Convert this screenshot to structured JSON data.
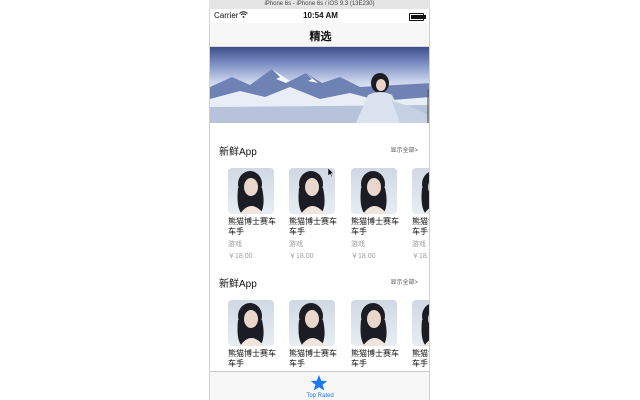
{
  "simulator": {
    "title": "iPhone 6s - iPhone 6s / iOS 9.3 (13E230)"
  },
  "status_bar": {
    "carrier": "Carrier",
    "time": "10:54 AM",
    "battery_level": 0.9
  },
  "nav": {
    "title": "精选"
  },
  "sections": [
    {
      "title": "新鲜App",
      "more": "显示全部>",
      "apps": [
        {
          "name": "熊猫博士赛车车手",
          "category": "游戏",
          "price": "￥18.00"
        },
        {
          "name": "熊猫博士赛车车手",
          "category": "游戏",
          "price": "￥18.00"
        },
        {
          "name": "熊猫博士赛车车手",
          "category": "游戏",
          "price": "￥18.00"
        },
        {
          "name": "熊猫博士赛车车手",
          "category": "游戏",
          "price": "￥18.00"
        }
      ]
    },
    {
      "title": "新鲜App",
      "more": "显示全部>",
      "apps": [
        {
          "name": "熊猫博士赛车车手"
        },
        {
          "name": "熊猫博士赛车车手"
        },
        {
          "name": "熊猫博士赛车车手"
        },
        {
          "name": "熊猫博士赛车车手"
        }
      ]
    }
  ],
  "tab_bar": {
    "items": [
      {
        "label": "Top Rated",
        "icon": "star-icon",
        "selected": true
      }
    ]
  },
  "colors": {
    "accent": "#1a7cf5",
    "secondary_text": "#a0a0a0"
  }
}
